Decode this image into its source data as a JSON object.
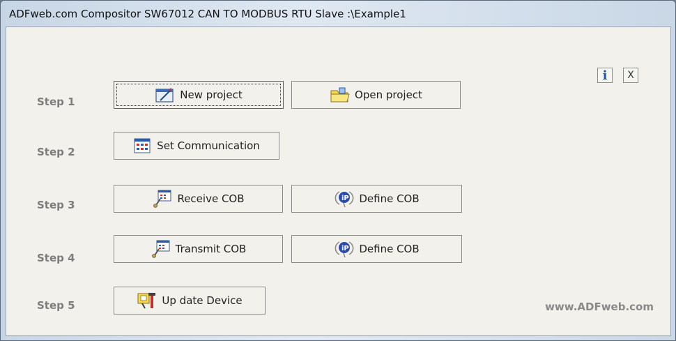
{
  "window": {
    "title": "ADFweb.com Compositor SW67012 CAN TO MODBUS RTU Slave :\\Example1"
  },
  "toolbar": {
    "info_label": "i",
    "close_label": "X"
  },
  "steps": [
    {
      "label": "Step 1",
      "buttons": [
        {
          "label": "New project",
          "icon": "new-project-icon"
        },
        {
          "label": "Open project",
          "icon": "folder-icon"
        }
      ]
    },
    {
      "label": "Step 2",
      "buttons": [
        {
          "label": "Set Communication",
          "icon": "communication-settings-icon"
        }
      ]
    },
    {
      "label": "Step 3",
      "buttons": [
        {
          "label": "Receive COB",
          "icon": "receive-cob-icon"
        },
        {
          "label": "Define COB",
          "icon": "define-cob-icon"
        }
      ]
    },
    {
      "label": "Step 4",
      "buttons": [
        {
          "label": "Transmit COB",
          "icon": "transmit-cob-icon"
        },
        {
          "label": "Define COB",
          "icon": "define-cob-icon"
        }
      ]
    },
    {
      "label": "Step 5",
      "buttons": [
        {
          "label": "Up date Device",
          "icon": "update-device-icon"
        }
      ]
    }
  ],
  "footer": {
    "url": "www.ADFweb.com"
  },
  "colors": {
    "info_blue": "#1f55b8",
    "step_label_gray": "#7d7d7d",
    "client_bg": "#f2f1ec"
  }
}
